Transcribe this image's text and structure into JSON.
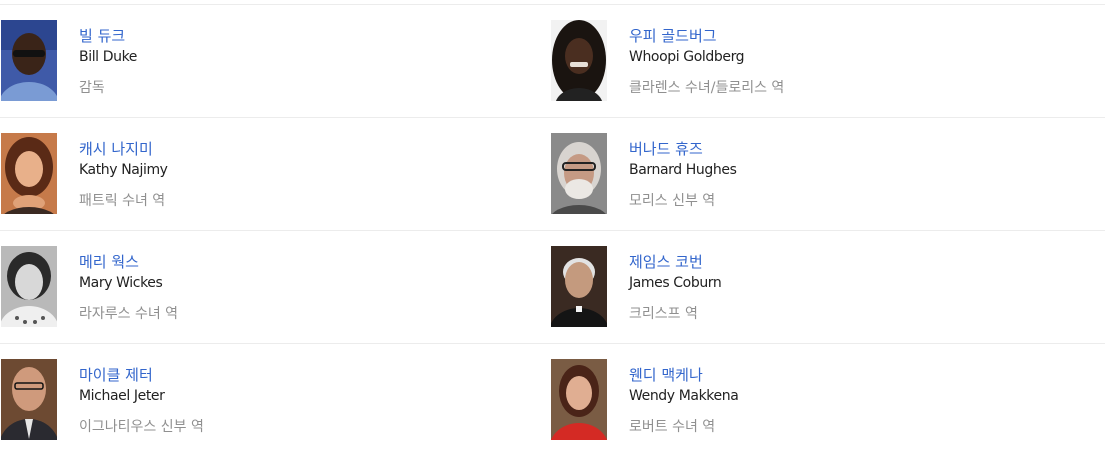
{
  "cast": [
    {
      "name_ko": "빌 듀크",
      "name_en": "Bill Duke",
      "role": "감독",
      "photo_icon": "portrait-photo-icon"
    },
    {
      "name_ko": "우피 골드버그",
      "name_en": "Whoopi Goldberg",
      "role": "클라렌스 수녀/들로리스 역",
      "photo_icon": "portrait-photo-icon"
    },
    {
      "name_ko": "캐시 나지미",
      "name_en": "Kathy Najimy",
      "role": "패트릭 수녀 역",
      "photo_icon": "portrait-photo-icon"
    },
    {
      "name_ko": "버나드 휴즈",
      "name_en": "Barnard Hughes",
      "role": "모리스 신부 역",
      "photo_icon": "portrait-photo-icon"
    },
    {
      "name_ko": "메리 웍스",
      "name_en": "Mary Wickes",
      "role": "라자루스 수녀 역",
      "photo_icon": "portrait-photo-icon"
    },
    {
      "name_ko": "제임스 코번",
      "name_en": "James Coburn",
      "role": "크리스프 역",
      "photo_icon": "portrait-photo-icon"
    },
    {
      "name_ko": "마이클 제터",
      "name_en": "Michael Jeter",
      "role": "이그나티우스 신부 역",
      "photo_icon": "portrait-photo-icon"
    },
    {
      "name_ko": "웬디 맥케나",
      "name_en": "Wendy Makkena",
      "role": "로버트 수녀 역",
      "photo_icon": "portrait-photo-icon"
    }
  ],
  "colors": {
    "link": "#3366cc",
    "name_en": "#222222",
    "role": "#909090",
    "divider": "#ececec"
  }
}
